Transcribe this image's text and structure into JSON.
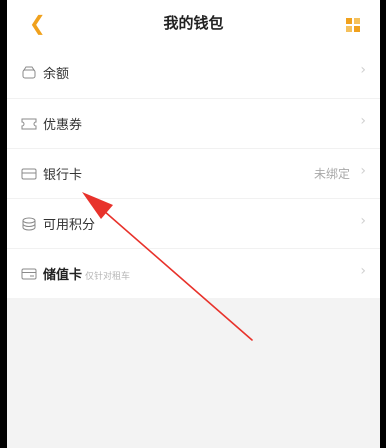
{
  "header": {
    "back_icon": "chevron-left",
    "title": "我的钱包",
    "menu_icon": "grid",
    "accent_color": "#f0a11d"
  },
  "menu": {
    "items": [
      {
        "icon": "wallet-outline",
        "label": "余额",
        "sublabel": "",
        "value": ""
      },
      {
        "icon": "coupon-outline",
        "label": "优惠券",
        "sublabel": "",
        "value": ""
      },
      {
        "icon": "card-outline",
        "label": "银行卡",
        "sublabel": "",
        "value": "未绑定"
      },
      {
        "icon": "coins-outline",
        "label": "可用积分",
        "sublabel": "",
        "value": ""
      },
      {
        "icon": "stored-card-outline",
        "label": "储值卡",
        "sublabel": "仅针对租车",
        "value": ""
      }
    ],
    "chevron": "›"
  },
  "annotation": {
    "arrow_color": "#e8322b"
  }
}
